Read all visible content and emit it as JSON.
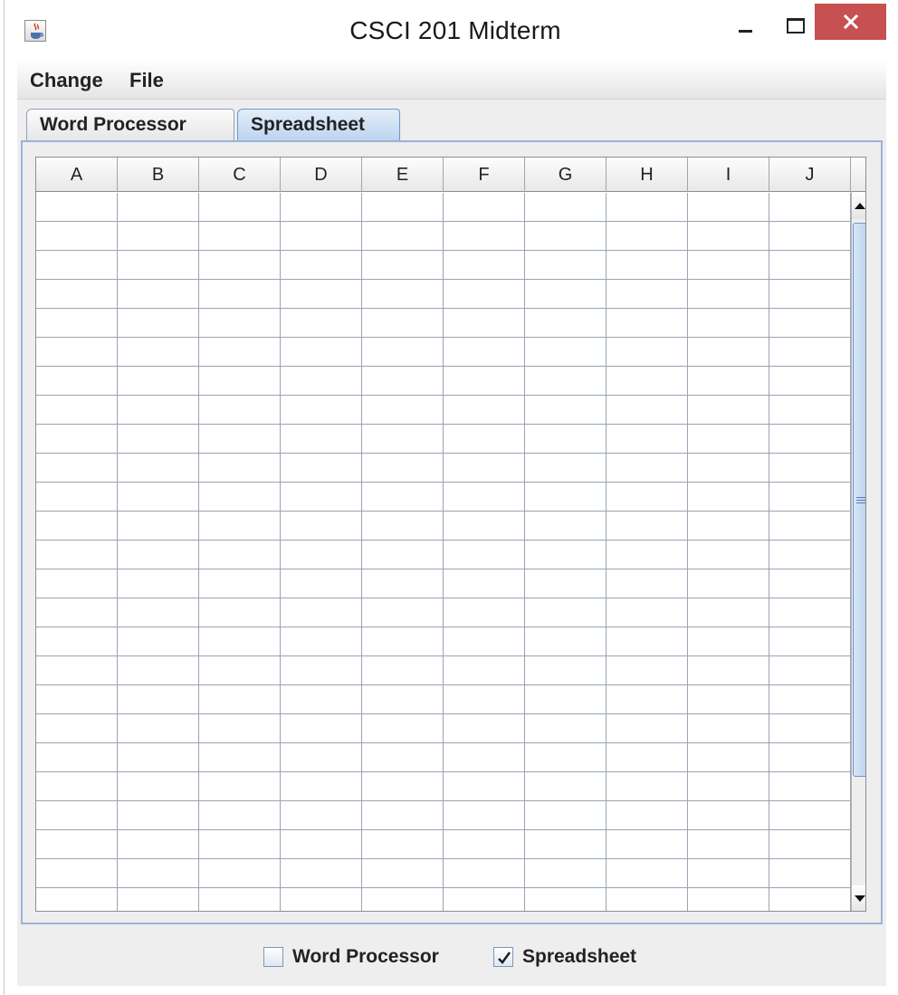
{
  "window": {
    "title": "CSCI 201 Midterm",
    "close_color": "#c75050"
  },
  "menubar": {
    "items": [
      {
        "label": "Change"
      },
      {
        "label": "File"
      }
    ]
  },
  "tabs": [
    {
      "label": "Word Processor",
      "selected": false
    },
    {
      "label": "Spreadsheet",
      "selected": true
    }
  ],
  "spreadsheet": {
    "columns": [
      "A",
      "B",
      "C",
      "D",
      "E",
      "F",
      "G",
      "H",
      "I",
      "J"
    ],
    "visible_rows": 25
  },
  "checkboxes": [
    {
      "label": "Word Processor",
      "checked": false
    },
    {
      "label": "Spreadsheet",
      "checked": true
    }
  ],
  "accent_color": "#9ab3d5"
}
